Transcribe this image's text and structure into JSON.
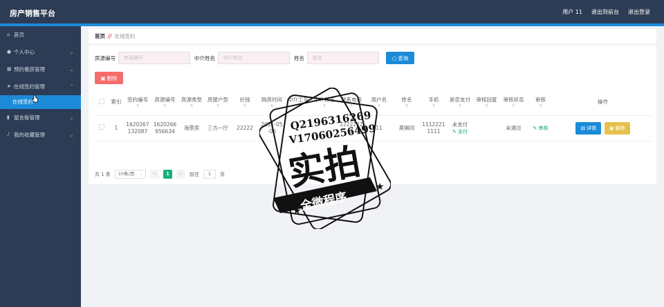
{
  "app": {
    "title": "房产销售平台"
  },
  "topbar": {
    "user": "用户 11",
    "back_to_front": "退出到前台",
    "logout": "退出登录"
  },
  "sidebar": {
    "items": [
      {
        "label": "首页",
        "icon": "home-icon"
      },
      {
        "label": "个人中心",
        "icon": "user-icon"
      },
      {
        "label": "预约看房管理",
        "icon": "grid-icon"
      },
      {
        "label": "在线签约管理",
        "icon": "send-icon"
      },
      {
        "label": "留言板管理",
        "icon": "chart-icon"
      },
      {
        "label": "我的收藏管理",
        "icon": "mic-icon"
      }
    ],
    "subitem": "在线签约"
  },
  "breadcrumb": {
    "home": "首页",
    "separator": "//",
    "current": "在线签约"
  },
  "search": {
    "f1_label": "房源编号",
    "f1_placeholder": "房源编号",
    "f2_label": "中介姓名",
    "f2_placeholder": "中介姓名",
    "f3_label": "姓名",
    "f3_placeholder": "姓名",
    "query": "查询"
  },
  "toolbar": {
    "delete": "删除"
  },
  "table": {
    "headers": [
      "索引",
      "签约编号",
      "房源编号",
      "房源类型",
      "房屋户型",
      "价钱",
      "购房时间",
      "中介工号",
      "中介姓名",
      "联系电话",
      "用户名",
      "姓名",
      "手机",
      "是否支付",
      "审核回复",
      "审核状态",
      "审核",
      "操作"
    ],
    "row": {
      "index": "1",
      "contract_no": "1620267132087",
      "house_no": "1620266956634",
      "house_type": "海景房",
      "layout": "三方一厅",
      "price": "22222",
      "buy_time": "2021-05-06",
      "agent_no": "",
      "agent_name": "",
      "phone": "22222222",
      "username": "11",
      "name": "莫琳冈",
      "mobile": "11122211111",
      "paid": "未支付",
      "pay_action": "支付",
      "reply": "",
      "status": "未通过",
      "review": "审核",
      "detail": "详情",
      "delete": "删除"
    }
  },
  "pager": {
    "total": "共 1 条",
    "page_size": "10条/页",
    "prev": "<",
    "page": "1",
    "next": ">",
    "goto": "前往",
    "goto_value": "1",
    "page_suffix": "页"
  },
  "watermark": {
    "line1": "Q2196316269",
    "line2": "V17060256499",
    "big": "实拍",
    "banner": "全微程序"
  }
}
